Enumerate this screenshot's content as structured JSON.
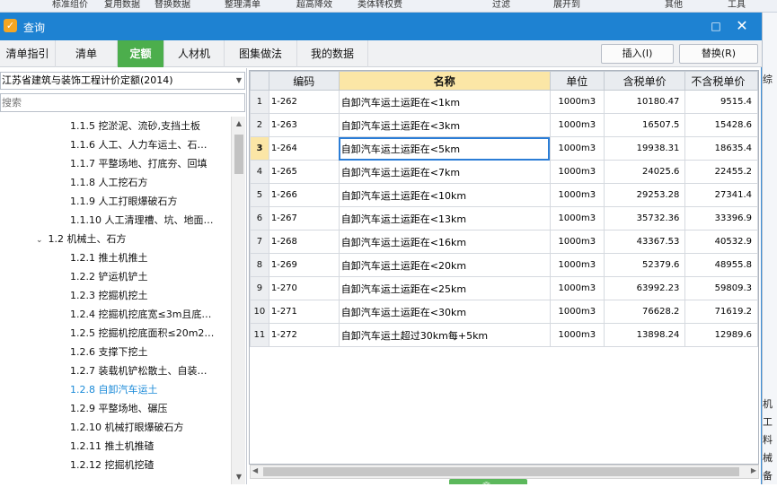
{
  "background": {
    "strip_items": [
      "标准组价",
      "复用数据",
      "替换数据",
      "整理清单",
      "超高降效",
      "类体转权费",
      "过滤",
      "展开到",
      "其他",
      "工具"
    ],
    "right_items": [
      "综",
      "机",
      "工",
      "料",
      "械",
      "备"
    ]
  },
  "dialog": {
    "title": "查询",
    "max_icon": "□",
    "close_icon": "✕",
    "accent": "#1e82d2",
    "tab_active_color": "#4cae4c"
  },
  "tabs": [
    {
      "label": "清单指引",
      "active": false
    },
    {
      "label": "清单",
      "active": false
    },
    {
      "label": "定额",
      "active": true
    },
    {
      "label": "人材机",
      "active": false
    },
    {
      "label": "图集做法",
      "active": false
    },
    {
      "label": "我的数据",
      "active": false
    }
  ],
  "toolbar": {
    "insert_label": "插入(I)",
    "replace_label": "替换(R)"
  },
  "left": {
    "library": "江苏省建筑与装饰工程计价定额(2014)",
    "search_placeholder": "搜索",
    "tree": [
      {
        "label": "1.1.5 挖淤泥、流砂,支挡土板",
        "level": 2,
        "expander": "",
        "selected": false
      },
      {
        "label": "1.1.6 人工、人力车运土、石…",
        "level": 2,
        "expander": "",
        "selected": false
      },
      {
        "label": "1.1.7 平整场地、打底夯、回填",
        "level": 2,
        "expander": "",
        "selected": false
      },
      {
        "label": "1.1.8 人工挖石方",
        "level": 2,
        "expander": "",
        "selected": false
      },
      {
        "label": "1.1.9 人工打眼爆破石方",
        "level": 2,
        "expander": "",
        "selected": false
      },
      {
        "label": "1.1.10 人工清理槽、坑、地面…",
        "level": 2,
        "expander": "",
        "selected": false
      },
      {
        "label": "1.2 机械土、石方",
        "level": 1,
        "expander": "⌄",
        "selected": false
      },
      {
        "label": "1.2.1 推土机推土",
        "level": 2,
        "expander": "",
        "selected": false
      },
      {
        "label": "1.2.2 铲运机铲土",
        "level": 2,
        "expander": "",
        "selected": false
      },
      {
        "label": "1.2.3 挖掘机挖土",
        "level": 2,
        "expander": "",
        "selected": false
      },
      {
        "label": "1.2.4 挖掘机挖底宽≤3m且底…",
        "level": 2,
        "expander": "",
        "selected": false
      },
      {
        "label": "1.2.5 挖掘机挖底面积≤20m2…",
        "level": 2,
        "expander": "",
        "selected": false
      },
      {
        "label": "1.2.6 支撑下挖土",
        "level": 2,
        "expander": "",
        "selected": false
      },
      {
        "label": "1.2.7 装载机铲松散土、自装…",
        "level": 2,
        "expander": "",
        "selected": false
      },
      {
        "label": "1.2.8 自卸汽车运土",
        "level": 2,
        "expander": "",
        "selected": true
      },
      {
        "label": "1.2.9 平整场地、碾压",
        "level": 2,
        "expander": "",
        "selected": false
      },
      {
        "label": "1.2.10 机械打眼爆破石方",
        "level": 2,
        "expander": "",
        "selected": false
      },
      {
        "label": "1.2.11 推土机推碴",
        "level": 2,
        "expander": "",
        "selected": false
      },
      {
        "label": "1.2.12 挖掘机挖碴",
        "level": 2,
        "expander": "",
        "selected": false
      }
    ],
    "scroll_up_icon": "▲",
    "scroll_down_icon": "▼"
  },
  "grid": {
    "headers": {
      "code": "编码",
      "name": "名称",
      "unit": "单位",
      "tax_price": "含税单价",
      "notax_price": "不含税单价"
    },
    "current_row": 3,
    "rows": [
      {
        "n": "1",
        "code": "1-262",
        "name": "自卸汽车运土运距在<1km",
        "unit": "1000m3",
        "tax": "10180.47",
        "notax": "9515.4"
      },
      {
        "n": "2",
        "code": "1-263",
        "name": "自卸汽车运土运距在<3km",
        "unit": "1000m3",
        "tax": "16507.5",
        "notax": "15428.6"
      },
      {
        "n": "3",
        "code": "1-264",
        "name": "自卸汽车运土运距在<5km",
        "unit": "1000m3",
        "tax": "19938.31",
        "notax": "18635.4"
      },
      {
        "n": "4",
        "code": "1-265",
        "name": "自卸汽车运土运距在<7km",
        "unit": "1000m3",
        "tax": "24025.6",
        "notax": "22455.2"
      },
      {
        "n": "5",
        "code": "1-266",
        "name": "自卸汽车运土运距在<10km",
        "unit": "1000m3",
        "tax": "29253.28",
        "notax": "27341.4"
      },
      {
        "n": "6",
        "code": "1-267",
        "name": "自卸汽车运土运距在<13km",
        "unit": "1000m3",
        "tax": "35732.36",
        "notax": "33396.9"
      },
      {
        "n": "7",
        "code": "1-268",
        "name": "自卸汽车运土运距在<16km",
        "unit": "1000m3",
        "tax": "43367.53",
        "notax": "40532.9"
      },
      {
        "n": "8",
        "code": "1-269",
        "name": "自卸汽车运土运距在<20km",
        "unit": "1000m3",
        "tax": "52379.6",
        "notax": "48955.8"
      },
      {
        "n": "9",
        "code": "1-270",
        "name": "自卸汽车运土运距在<25km",
        "unit": "1000m3",
        "tax": "63992.23",
        "notax": "59809.3"
      },
      {
        "n": "10",
        "code": "1-271",
        "name": "自卸汽车运土运距在<30km",
        "unit": "1000m3",
        "tax": "76628.2",
        "notax": "71619.2"
      },
      {
        "n": "11",
        "code": "1-272",
        "name": "自卸汽车运土超过30km每+5km",
        "unit": "1000m3",
        "tax": "13898.24",
        "notax": "12989.6"
      }
    ],
    "scroll_left_icon": "◀",
    "scroll_right_icon": "▶",
    "splitter_icon": "︽"
  }
}
